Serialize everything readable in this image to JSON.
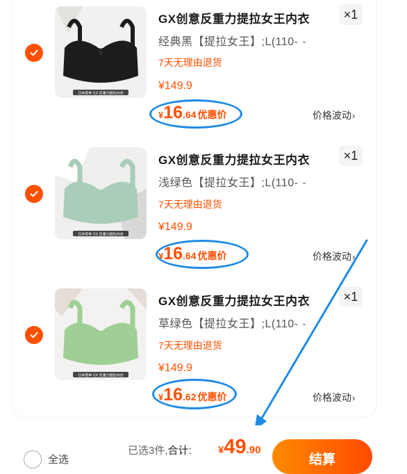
{
  "items": [
    {
      "title": "GX创意反重力提拉女王内衣",
      "qty": "×1",
      "variant": "经典黑【提拉女王】;L(110-",
      "return_policy": "7天无理由退货",
      "orig_price": "¥149.9",
      "deal_currency": "¥",
      "deal_int": "16",
      "deal_dec": ".64",
      "deal_label": "优惠价",
      "trend_label": "价格波动",
      "color": "#1c1c1e",
      "badge_text": "日本原单 GX 反重力提拉内衣"
    },
    {
      "title": "GX创意反重力提拉女王内衣",
      "qty": "×1",
      "variant": "浅绿色【提拉女王】;L(110-",
      "return_policy": "7天无理由退货",
      "orig_price": "¥149.9",
      "deal_currency": "¥",
      "deal_int": "16",
      "deal_dec": ".64",
      "deal_label": "优惠价",
      "trend_label": "价格波动",
      "color": "#a9cdb8",
      "badge_text": "日本原单 GX 反重力提拉内衣"
    },
    {
      "title": "GX创意反重力提拉女王内衣",
      "qty": "×1",
      "variant": "草绿色【提拉女王】;L(110-",
      "return_policy": "7天无理由退货",
      "orig_price": "¥149.9",
      "deal_currency": "¥",
      "deal_int": "16",
      "deal_dec": ".62",
      "deal_label": "优惠价",
      "trend_label": "价格波动",
      "color": "#9fcf94",
      "badge_text": "日本原单 GX 反重力提拉内衣"
    }
  ],
  "footer": {
    "select_all": "全选",
    "selected_count": "已选3件,",
    "total_label": "合计:",
    "total_currency": "¥",
    "total_int": "49",
    "total_dec": ".90",
    "checkout": "结算"
  },
  "colors": {
    "accent": "#ff5000",
    "annotation": "#1e8be6"
  }
}
